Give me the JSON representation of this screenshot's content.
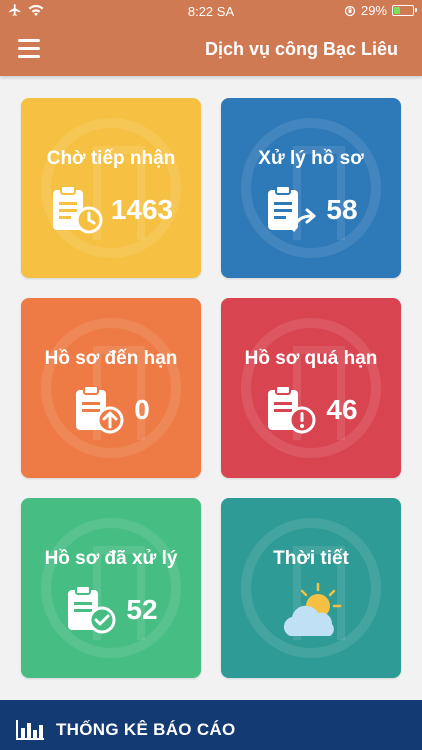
{
  "status_bar": {
    "time": "8:22 SA",
    "battery": "29%",
    "icons": [
      "airplane-icon",
      "wifi-icon",
      "orientation-lock-icon",
      "battery-icon"
    ]
  },
  "header": {
    "title": "Dịch vụ công Bạc Liêu",
    "menu_icon": "hamburger-menu-icon"
  },
  "tiles": [
    {
      "label": "Chờ tiếp nhận",
      "count": "1463",
      "icon": "clipboard-clock-icon",
      "color": "#f6c142"
    },
    {
      "label": "Xử lý hồ sơ",
      "count": "58",
      "icon": "clipboard-share-icon",
      "color": "#2e79b8"
    },
    {
      "label": "Hồ sơ đến hạn",
      "count": "0",
      "icon": "clipboard-upload-icon",
      "color": "#ee7b45"
    },
    {
      "label": "Hồ sơ quá hạn",
      "count": "46",
      "icon": "clipboard-alert-icon",
      "color": "#d84551"
    },
    {
      "label": "Hồ sơ đã xử lý",
      "count": "52",
      "icon": "clipboard-check-icon",
      "color": "#46bd83"
    },
    {
      "label": "Thời tiết",
      "count": "",
      "icon": "weather-sun-cloud-icon",
      "color": "#2f9b96"
    }
  ],
  "watermark_text": "HÀ NỘI",
  "bottom_bar": {
    "label": "THỐNG KÊ BÁO CÁO",
    "icon": "bar-chart-icon",
    "color": "#133a73"
  },
  "brand_color": "#d07a54"
}
